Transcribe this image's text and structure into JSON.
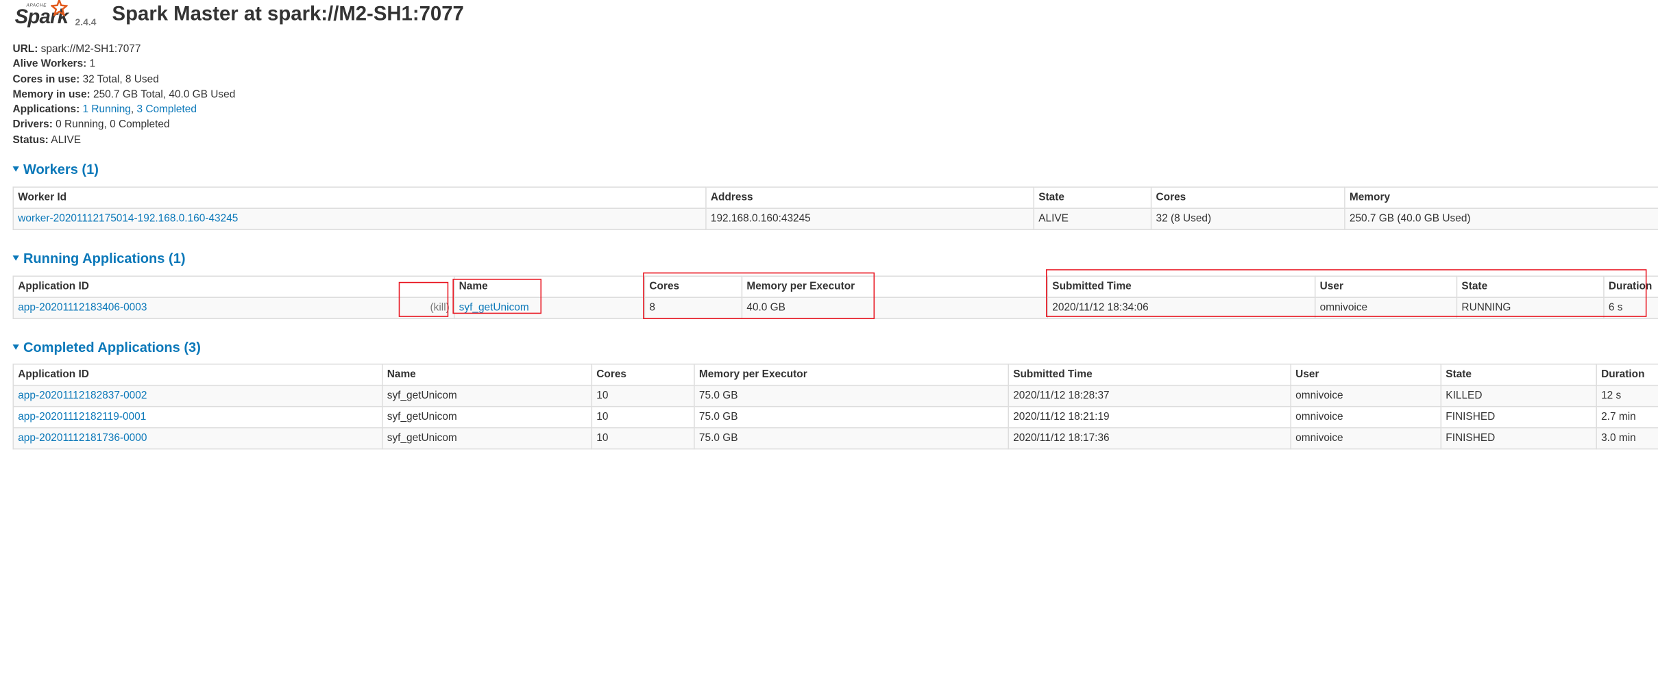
{
  "header": {
    "logo_small": "APACHE",
    "logo_word": "Spark",
    "version": "2.4.4",
    "title": "Spark Master at spark://M2-SH1:7077"
  },
  "summary": {
    "url_label": "URL:",
    "url_value": "spark://M2-SH1:7077",
    "workers_label": "Alive Workers:",
    "workers_value": "1",
    "cores_label": "Cores in use:",
    "cores_value": "32 Total, 8 Used",
    "memory_label": "Memory in use:",
    "memory_value": "250.7 GB Total, 40.0 GB Used",
    "apps_label": "Applications:",
    "apps_running": "1 Running",
    "apps_sep": ", ",
    "apps_completed": "3 Completed",
    "drivers_label": "Drivers:",
    "drivers_value": "0 Running, 0 Completed",
    "status_label": "Status:",
    "status_value": "ALIVE"
  },
  "workers": {
    "title": "Workers (1)",
    "headers": [
      "Worker Id",
      "Address",
      "State",
      "Cores",
      "Memory"
    ],
    "rows": [
      [
        "worker-20201112175014-192.168.0.160-43245",
        "192.168.0.160:43245",
        "ALIVE",
        "32 (8 Used)",
        "250.7 GB (40.0 GB Used)"
      ]
    ]
  },
  "running": {
    "title": "Running Applications (1)",
    "headers": [
      "Application ID",
      "Name",
      "Cores",
      "Memory per Executor",
      "Submitted Time",
      "User",
      "State",
      "Duration"
    ],
    "kill_label": "(kill)",
    "rows": [
      [
        "app-20201112183406-0003",
        "syf_getUnicom",
        "8",
        "40.0 GB",
        "2020/11/12 18:34:06",
        "omnivoice",
        "RUNNING",
        "6 s"
      ]
    ]
  },
  "completed": {
    "title": "Completed Applications (3)",
    "headers": [
      "Application ID",
      "Name",
      "Cores",
      "Memory per Executor",
      "Submitted Time",
      "User",
      "State",
      "Duration"
    ],
    "rows": [
      [
        "app-20201112182837-0002",
        "syf_getUnicom",
        "10",
        "75.0 GB",
        "2020/11/12 18:28:37",
        "omnivoice",
        "KILLED",
        "12 s"
      ],
      [
        "app-20201112182119-0001",
        "syf_getUnicom",
        "10",
        "75.0 GB",
        "2020/11/12 18:21:19",
        "omnivoice",
        "FINISHED",
        "2.7 min"
      ],
      [
        "app-20201112181736-0000",
        "syf_getUnicom",
        "10",
        "75.0 GB",
        "2020/11/12 18:17:36",
        "omnivoice",
        "FINISHED",
        "3.0 min"
      ]
    ]
  },
  "colors": {
    "link": "#0b78b9",
    "highlight": "#e8141f",
    "text": "#333333"
  }
}
